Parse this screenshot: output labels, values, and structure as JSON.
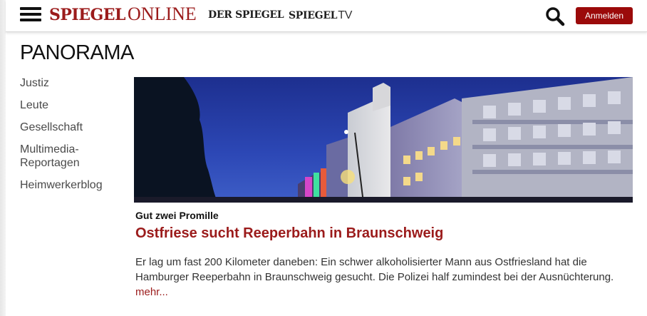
{
  "header": {
    "logo_bold": "SPIEGEL",
    "logo_light": "ONLINE",
    "brand_link_1": "DER SPIEGEL",
    "brand_link_2_bold": "SPIEGEL",
    "brand_link_2_light": "TV",
    "login_label": "Anmelden",
    "icons": {
      "menu": "hamburger-menu-icon",
      "search": "search-icon"
    },
    "colors": {
      "brand_red": "#9b1b1b",
      "button_red": "#9b0a0a"
    }
  },
  "section": {
    "title": "PANORAMA"
  },
  "subnav": {
    "items": [
      {
        "label": "Justiz"
      },
      {
        "label": "Leute"
      },
      {
        "label": "Gesellschaft"
      },
      {
        "label": "Multimedia-\nReportagen"
      },
      {
        "label": "Heimwerkerblog"
      }
    ]
  },
  "article": {
    "kicker": "Gut zwei Promille",
    "headline": "Ostfriese sucht Reeperbahn in Braunschweig",
    "teaser": "Er lag um fast 200 Kilometer daneben: Ein schwer alkoholisierter Mann aus Ostfriesland hat die Hamburger Reeperbahn in Braunschweig gesucht. Die Polizei half zumindest bei der Ausnüchterung.",
    "more": "mehr..."
  }
}
